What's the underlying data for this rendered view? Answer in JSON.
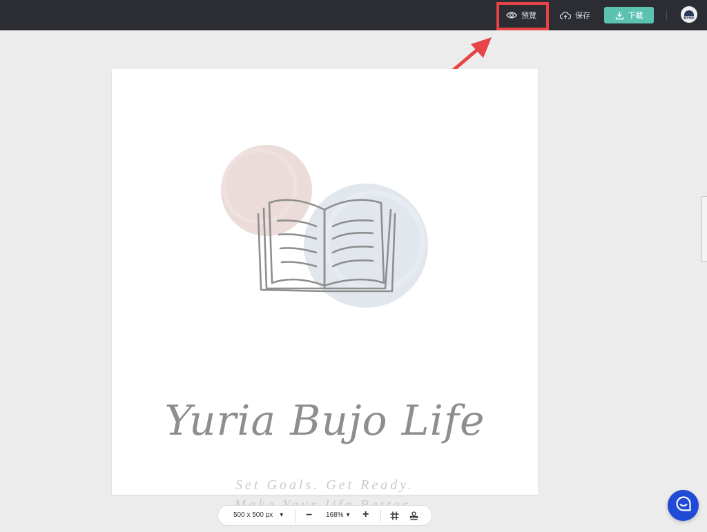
{
  "topbar": {
    "preview_label": "預覽",
    "save_label": "保存",
    "download_label": "下載",
    "avatar_label": "寫手設計"
  },
  "canvas": {
    "title": "Yuria Bujo Life",
    "subtitle_line1": "Set Goals. Get Ready.",
    "subtitle_line2": "Make Your life Better."
  },
  "bottombar": {
    "size": "500 x 500 px",
    "size_caret": "▾",
    "zoom": "168%",
    "zoom_caret": "▾",
    "minus": "−",
    "plus": "+"
  },
  "colors": {
    "topbar_bg": "#2b2d33",
    "download_accent": "#5cc2b0",
    "highlight": "#e64446",
    "chat": "#1f4bd6"
  },
  "icons": [
    "eye-icon",
    "cloud-upload-icon",
    "download-icon",
    "grid-icon",
    "stamp-icon",
    "chat-icon",
    "open-book-icon"
  ]
}
